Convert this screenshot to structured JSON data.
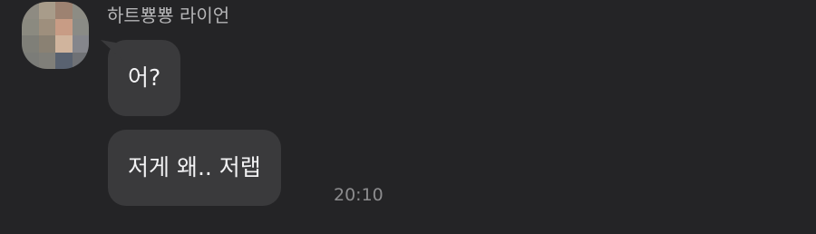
{
  "chat": {
    "sender_name": "하트뿅뿅 라이언",
    "avatar_icon": "blurred-profile-photo",
    "messages": [
      {
        "text": "어?"
      },
      {
        "text": "저게 왜.. 저랩"
      }
    ],
    "timestamp": "20:10"
  },
  "colors": {
    "background": "#242426",
    "bubble": "#3a3a3c",
    "message_text": "#f2f2f4",
    "sender_text": "#b5b5b7",
    "timestamp_text": "#8c8c8e"
  }
}
